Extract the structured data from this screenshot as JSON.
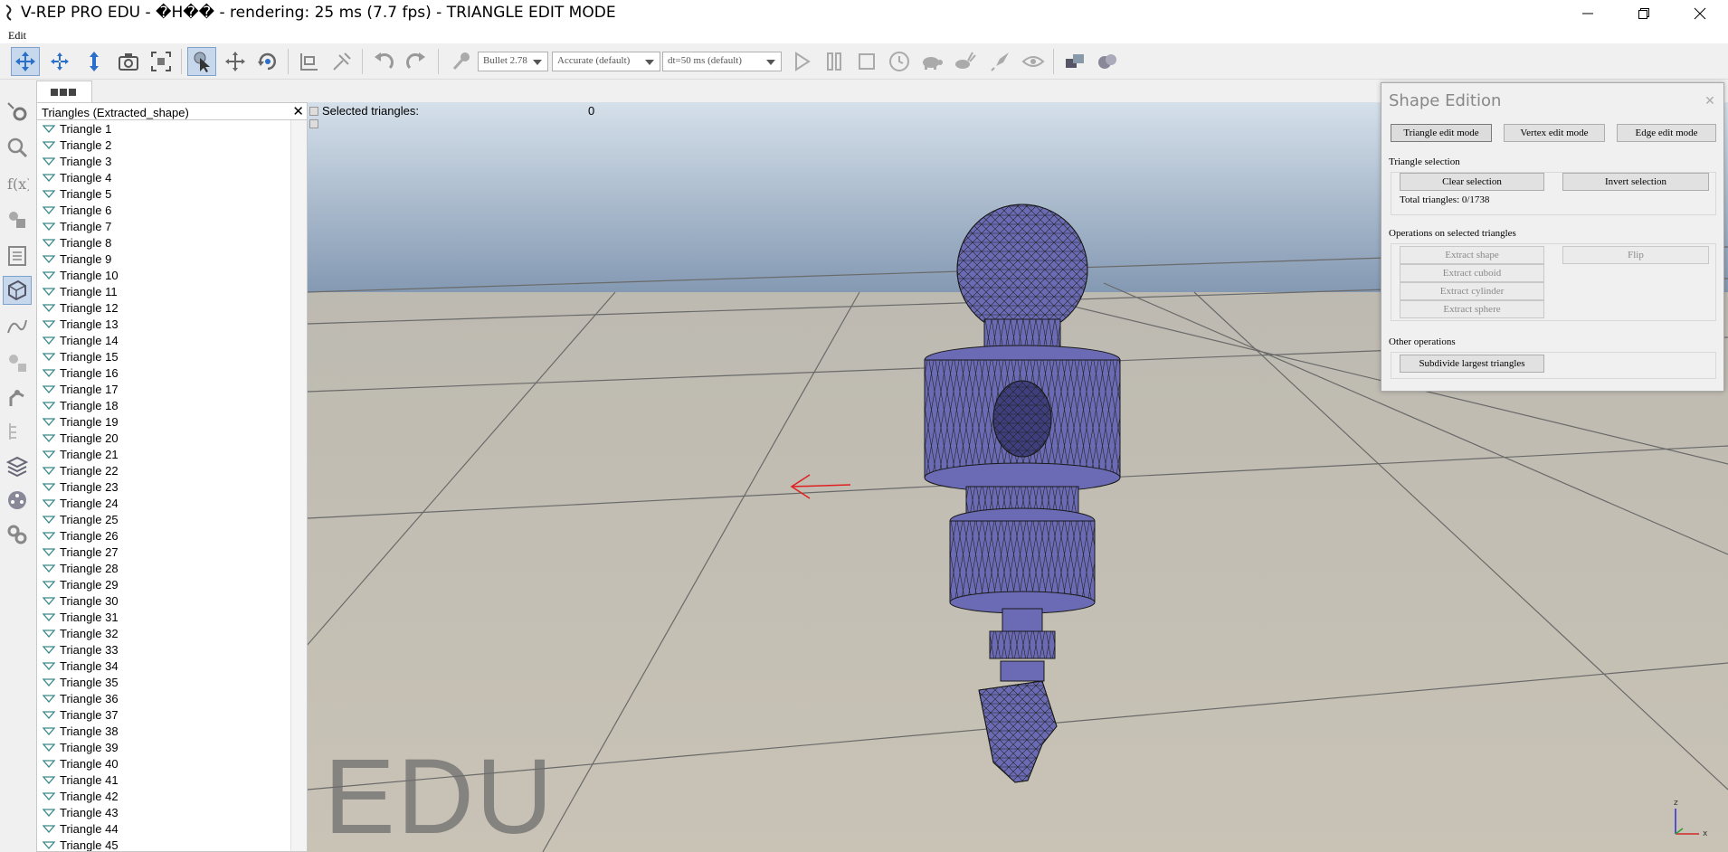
{
  "window": {
    "title": "V-REP PRO EDU - �H�� - rendering: 25 ms (7.7 fps) - TRIANGLE EDIT MODE"
  },
  "menu": {
    "edit": "Edit"
  },
  "toolbar": {
    "engine": "Bullet 2.78",
    "accuracy": "Accurate (default)",
    "timestep": "dt=50 ms (default)"
  },
  "hierarchy": {
    "header": "Triangles (Extracted_shape)",
    "items": [
      "Triangle 1",
      "Triangle 2",
      "Triangle 3",
      "Triangle 4",
      "Triangle 5",
      "Triangle 6",
      "Triangle 7",
      "Triangle 8",
      "Triangle 9",
      "Triangle 10",
      "Triangle 11",
      "Triangle 12",
      "Triangle 13",
      "Triangle 14",
      "Triangle 15",
      "Triangle 16",
      "Triangle 17",
      "Triangle 18",
      "Triangle 19",
      "Triangle 20",
      "Triangle 21",
      "Triangle 22",
      "Triangle 23",
      "Triangle 24",
      "Triangle 25",
      "Triangle 26",
      "Triangle 27",
      "Triangle 28",
      "Triangle 29",
      "Triangle 30",
      "Triangle 31",
      "Triangle 32",
      "Triangle 33",
      "Triangle 34",
      "Triangle 35",
      "Triangle 36",
      "Triangle 37",
      "Triangle 38",
      "Triangle 39",
      "Triangle 40",
      "Triangle 41",
      "Triangle 42",
      "Triangle 43",
      "Triangle 44",
      "Triangle 45"
    ]
  },
  "scene": {
    "selected_label": "Selected triangles:",
    "selected_value": "0",
    "watermark": "EDU"
  },
  "dialog": {
    "title": "Shape Edition",
    "triangle_mode": "Triangle edit mode",
    "vertex_mode": "Vertex edit mode",
    "edge_mode": "Edge edit mode",
    "triangle_selection": "Triangle selection",
    "clear_selection": "Clear selection",
    "invert_selection": "Invert selection",
    "total": "Total triangles: 0/1738",
    "ops_label": "Operations on selected triangles",
    "extract_shape": "Extract shape",
    "flip": "Flip",
    "extract_cuboid": "Extract cuboid",
    "extract_cylinder": "Extract cylinder",
    "extract_sphere": "Extract sphere",
    "other_label": "Other operations",
    "subdivide": "Subdivide largest triangles"
  },
  "colors": {
    "shape": "#6b6bb5",
    "accent": "#2a6fc9"
  }
}
